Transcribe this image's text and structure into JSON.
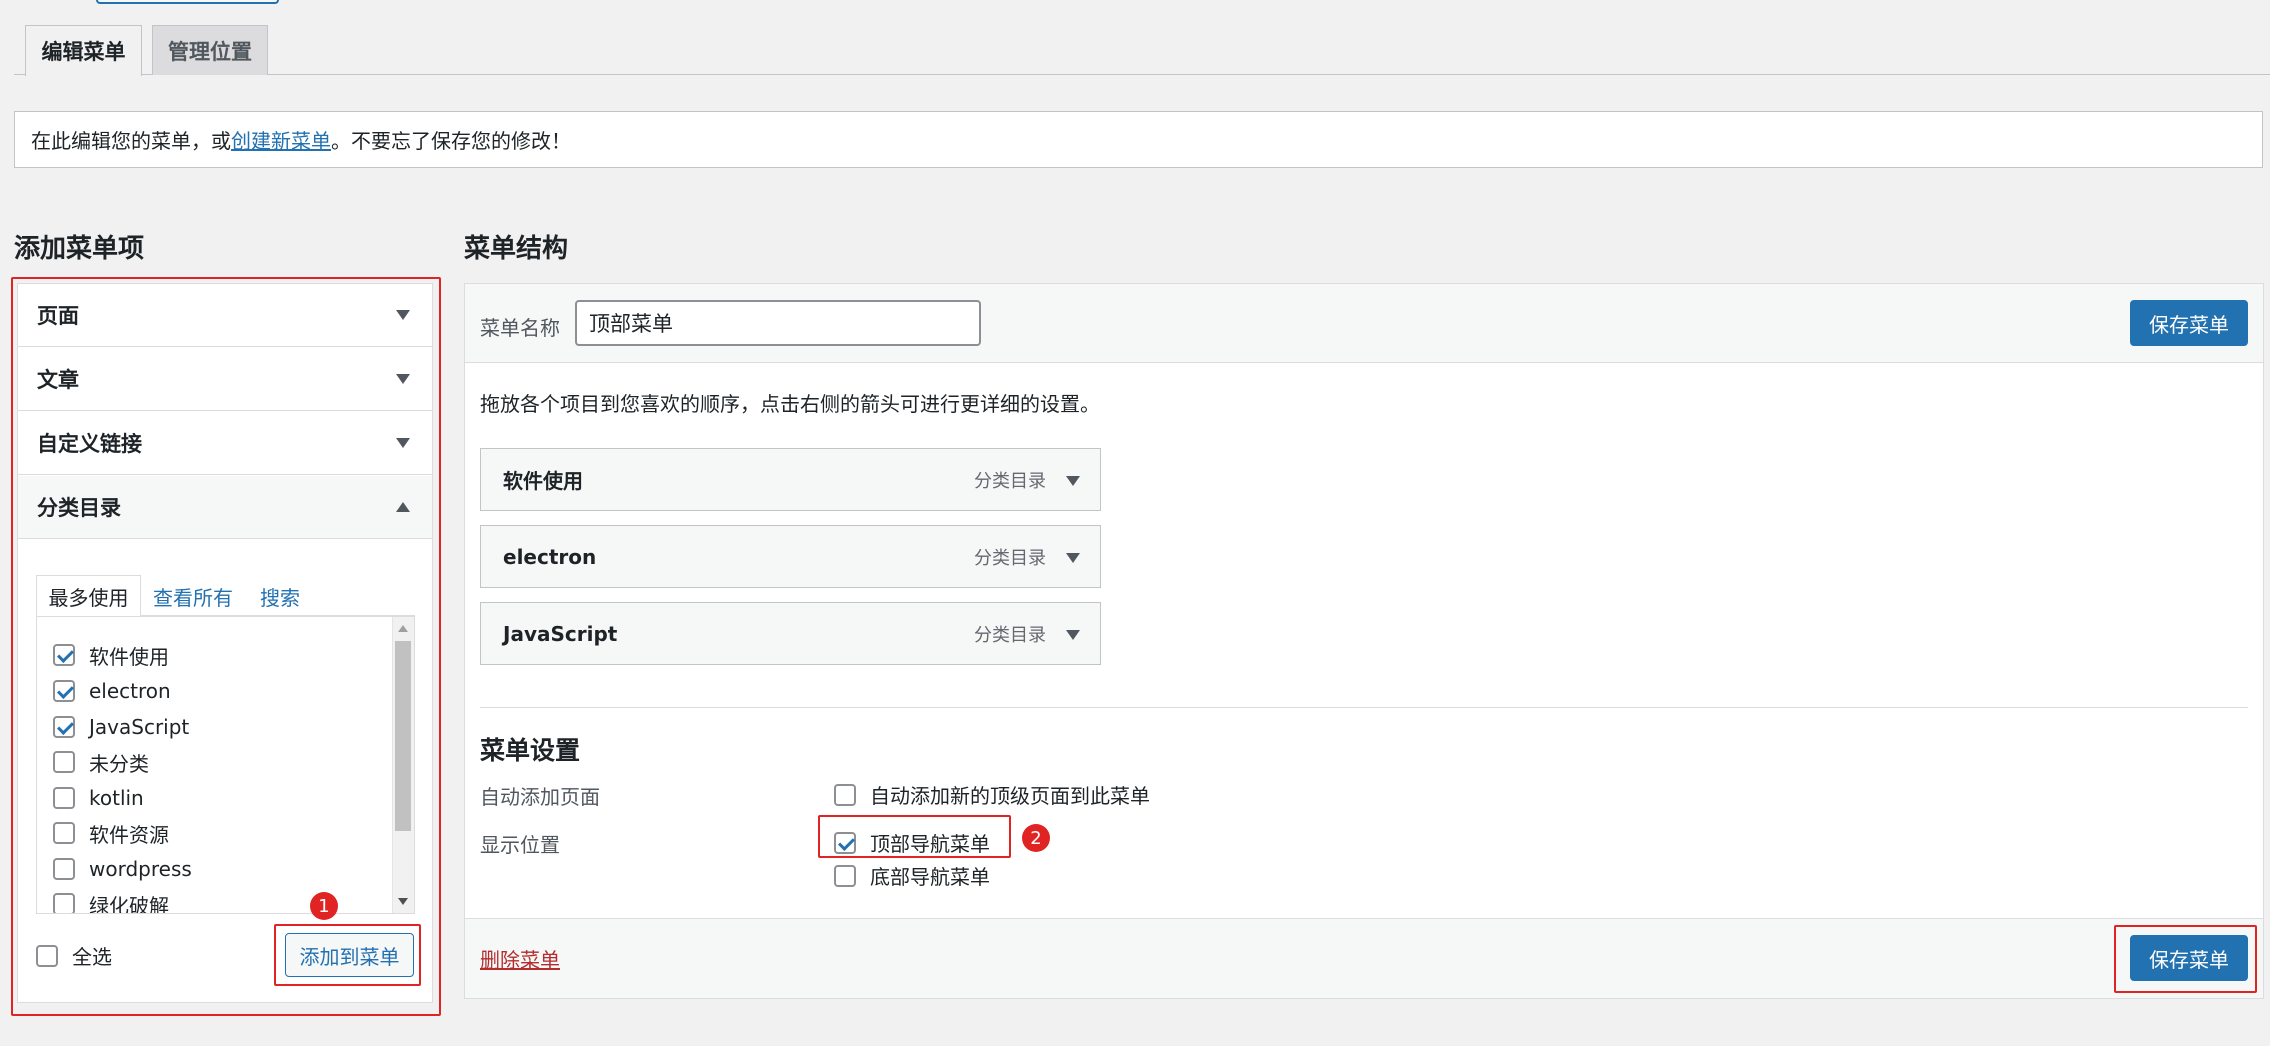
{
  "tabs": {
    "edit": "编辑菜单",
    "locations": "管理位置"
  },
  "notice": {
    "before": "在此编辑您的菜单，或",
    "link": "创建新菜单",
    "after": "。不要忘了保存您的修改！"
  },
  "add_items": {
    "title": "添加菜单项",
    "sections": [
      "页面",
      "文章",
      "自定义链接",
      "分类目录"
    ],
    "subtabs": {
      "most_used": "最多使用",
      "view_all": "查看所有",
      "search": "搜索"
    },
    "categories": [
      {
        "label": "软件使用",
        "checked": true
      },
      {
        "label": "electron",
        "checked": true
      },
      {
        "label": "JavaScript",
        "checked": true
      },
      {
        "label": "未分类",
        "checked": false
      },
      {
        "label": "kotlin",
        "checked": false
      },
      {
        "label": "软件资源",
        "checked": false
      },
      {
        "label": "wordpress",
        "checked": false
      },
      {
        "label": "绿化破解",
        "checked": false
      }
    ],
    "select_all": "全选",
    "add_button": "添加到菜单",
    "badge": "1"
  },
  "structure": {
    "title": "菜单结构",
    "name_label": "菜单名称",
    "name_value": "顶部菜单",
    "save_button": "保存菜单",
    "instructions": "拖放各个项目到您喜欢的顺序，点击右侧的箭头可进行更详细的设置。",
    "items": [
      {
        "title": "软件使用",
        "type": "分类目录"
      },
      {
        "title": "electron",
        "type": "分类目录"
      },
      {
        "title": "JavaScript",
        "type": "分类目录"
      }
    ]
  },
  "settings": {
    "title": "菜单设置",
    "auto_add_label": "自动添加页面",
    "auto_add_option": "自动添加新的顶级页面到此菜单",
    "location_label": "显示位置",
    "location_top": "顶部导航菜单",
    "location_bottom": "底部导航菜单",
    "badge": "2"
  },
  "footer": {
    "delete": "删除菜单",
    "save_button": "保存菜单"
  },
  "colors": {
    "accent": "#2271b1",
    "highlight": "#e02424",
    "danger": "#b32d2e"
  }
}
